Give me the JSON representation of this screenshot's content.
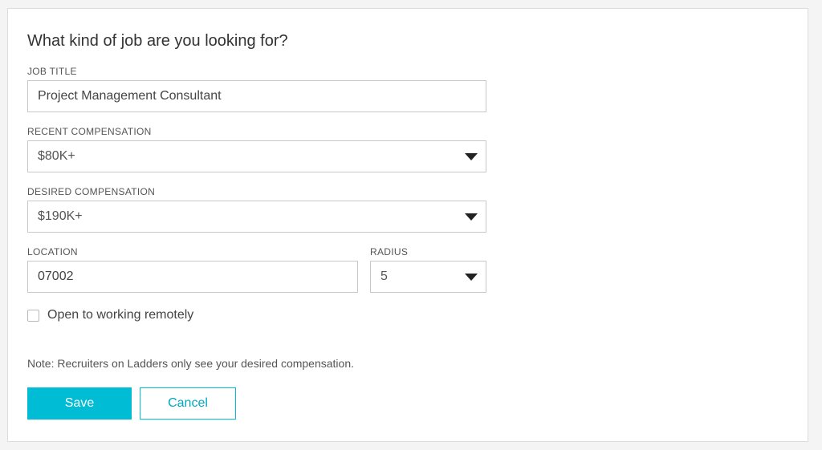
{
  "form": {
    "title": "What kind of job are you looking for?",
    "job_title": {
      "label": "JOB TITLE",
      "value": "Project Management Consultant"
    },
    "recent_compensation": {
      "label": "RECENT COMPENSATION",
      "selected": "$80K+"
    },
    "desired_compensation": {
      "label": "DESIRED COMPENSATION",
      "selected": "$190K+"
    },
    "location": {
      "label": "LOCATION",
      "value": "07002"
    },
    "radius": {
      "label": "RADIUS",
      "selected": "5"
    },
    "remote": {
      "label": "Open to working remotely",
      "checked": false
    },
    "note": "Note: Recruiters on Ladders only see your desired compensation.",
    "save_label": "Save",
    "cancel_label": "Cancel"
  },
  "colors": {
    "accent": "#00bcd4",
    "background": "#f4f4f4",
    "card": "#ffffff"
  }
}
